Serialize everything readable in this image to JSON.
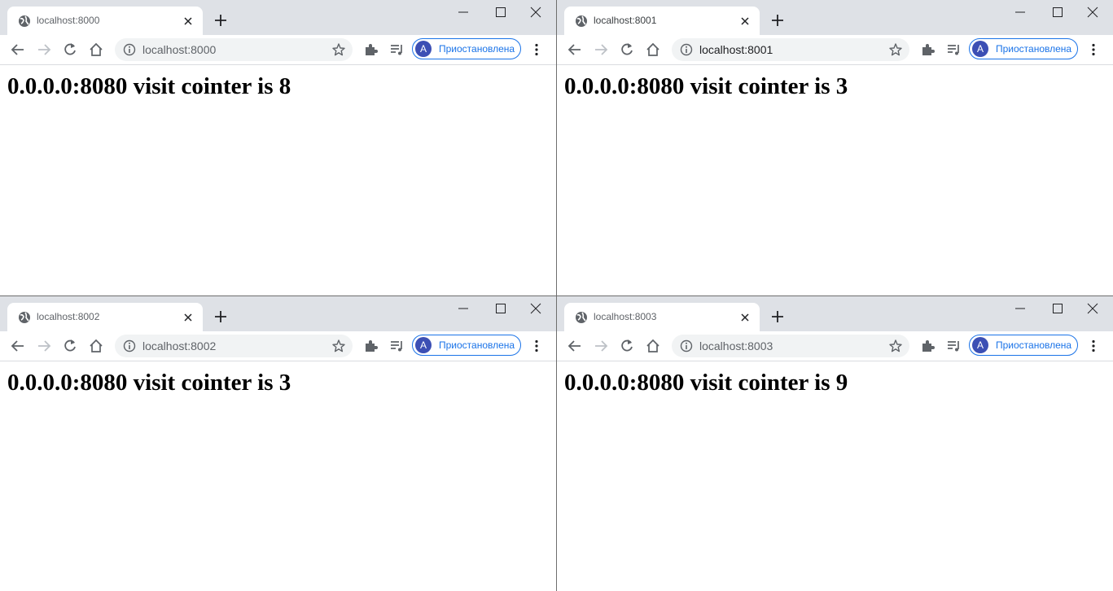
{
  "windows": [
    {
      "active": false,
      "tab_title": "localhost:8000",
      "address": "localhost:8000",
      "profile_initial": "A",
      "profile_label": "Приостановлена",
      "heading": "0.0.0.0:8080 visit cointer is 8"
    },
    {
      "active": true,
      "tab_title": "localhost:8001",
      "address": "localhost:8001",
      "profile_initial": "A",
      "profile_label": "Приостановлена",
      "heading": "0.0.0.0:8080 visit cointer is 3"
    },
    {
      "active": false,
      "tab_title": "localhost:8002",
      "address": "localhost:8002",
      "profile_initial": "A",
      "profile_label": "Приостановлена",
      "heading": "0.0.0.0:8080 visit cointer is 3"
    },
    {
      "active": false,
      "tab_title": "localhost:8003",
      "address": "localhost:8003",
      "profile_initial": "A",
      "profile_label": "Приостановлена",
      "heading": "0.0.0.0:8080 visit cointer is 9"
    }
  ],
  "icons": {
    "favicon": "globe-icon",
    "tab_close": "close-icon",
    "new_tab": "plus-icon",
    "minimize": "minimize-icon",
    "maximize": "maximize-icon",
    "window_close": "close-icon",
    "back": "arrow-left-icon",
    "forward": "arrow-right-icon",
    "reload": "reload-icon",
    "home": "home-icon",
    "site_info": "info-icon",
    "bookmark": "star-icon",
    "extensions": "puzzle-icon",
    "media": "media-queue-icon",
    "menu": "kebab-menu-icon"
  },
  "colors": {
    "titlebar": "#dee1e6",
    "accent": "#1a73e8",
    "avatar": "#3c4fb4"
  }
}
